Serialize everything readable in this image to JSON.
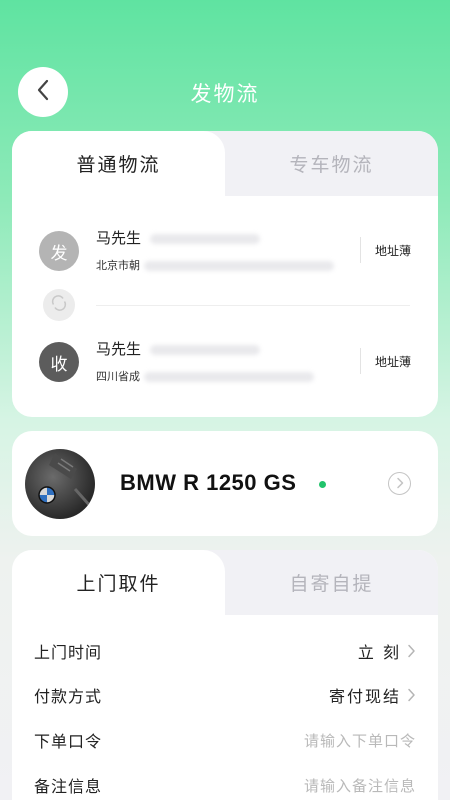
{
  "header": {
    "title": "发物流"
  },
  "logistics": {
    "tabs": [
      {
        "label": "普通物流",
        "active": true
      },
      {
        "label": "专车物流",
        "active": false
      }
    ],
    "sender": {
      "badge": "发",
      "name": "马先生",
      "address": "北京市朝",
      "book_label": "地址薄"
    },
    "receiver": {
      "badge": "收",
      "name": "马先生",
      "address": "四川省成",
      "book_label": "地址薄"
    }
  },
  "vehicle": {
    "name": "BMW R 1250 GS",
    "status_color": "#21c36b"
  },
  "pickup": {
    "tabs": [
      {
        "label": "上门取件",
        "active": true
      },
      {
        "label": "自寄自提",
        "active": false
      }
    ],
    "rows": [
      {
        "label": "上门时间",
        "value": "立 刻"
      },
      {
        "label": "付款方式",
        "value": "寄付现结"
      },
      {
        "label": "下单口令",
        "placeholder": "请输入下单口令"
      },
      {
        "label": "备注信息",
        "placeholder": "请输入备注信息"
      }
    ]
  },
  "colors": {
    "accent": "#5fe3a1",
    "background": "#f1f1f4"
  }
}
